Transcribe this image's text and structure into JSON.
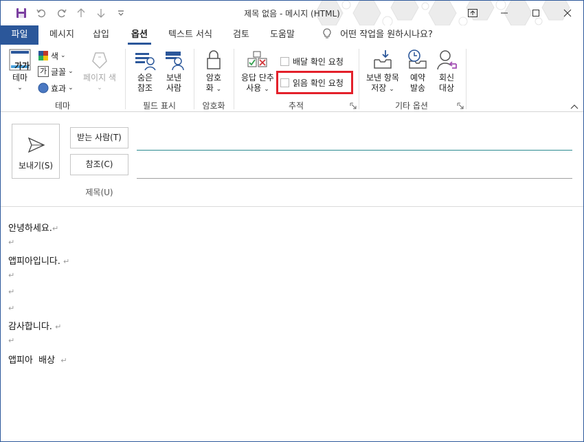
{
  "window": {
    "title": "제목 없음  -  메시지 (HTML)",
    "accent": "#2b579a",
    "highlight_color": "#e3202a"
  },
  "quick_access": [
    "save-icon",
    "undo-icon",
    "redo-icon",
    "up-arrow-icon",
    "down-arrow-icon",
    "customize-icon"
  ],
  "tabs": [
    {
      "label": "파일"
    },
    {
      "label": "메시지"
    },
    {
      "label": "삽입"
    },
    {
      "label": "옵션"
    },
    {
      "label": "텍스트 서식"
    },
    {
      "label": "검토"
    },
    {
      "label": "도움말"
    }
  ],
  "tell_me": "어떤 작업을 원하시나요?",
  "ribbon": {
    "theme_group": {
      "label": "테마",
      "theme_button": "테마",
      "theme_icon_text": "가가",
      "color": "색",
      "font": "글꼴",
      "font_icon_text": "가",
      "effects": "효과",
      "page_color": "페이지 색"
    },
    "fields_group": {
      "label": "필드 표시",
      "bcc": [
        "숨은",
        "참조"
      ],
      "from": [
        "보낸",
        "사람"
      ]
    },
    "encrypt_group": {
      "label": "암호화",
      "encrypt": [
        "암호",
        "화"
      ]
    },
    "tracking_group": {
      "label": "추적",
      "voting": [
        "응답 단추",
        "사용"
      ],
      "delivery_receipt": "배달 확인 요청",
      "read_receipt": "읽음 확인 요청"
    },
    "more_options_group": {
      "label": "기타 옵션",
      "save_sent": [
        "보낸 항목",
        "저장"
      ],
      "delay": [
        "예약",
        "발송"
      ],
      "reply_to": [
        "회신",
        "대상"
      ]
    }
  },
  "compose": {
    "send": "보내기(S)",
    "to": "받는 사람(T)",
    "cc": "참조(C)",
    "subject": "제목(U)"
  },
  "body_lines": [
    {
      "text": "안녕하세요.",
      "mark": "↵"
    },
    {
      "text": "",
      "mark": "↵"
    },
    {
      "text": "앱피아입니다. ",
      "mark": "↵"
    },
    {
      "text": "",
      "mark": "↵"
    },
    {
      "text": "",
      "mark": "↵"
    },
    {
      "text": "",
      "mark": "↵"
    },
    {
      "text": "감사합니다. ",
      "mark": "↵"
    },
    {
      "text": "",
      "mark": "↵"
    },
    {
      "text": "앱피아  배상  ",
      "mark": "↵"
    }
  ]
}
